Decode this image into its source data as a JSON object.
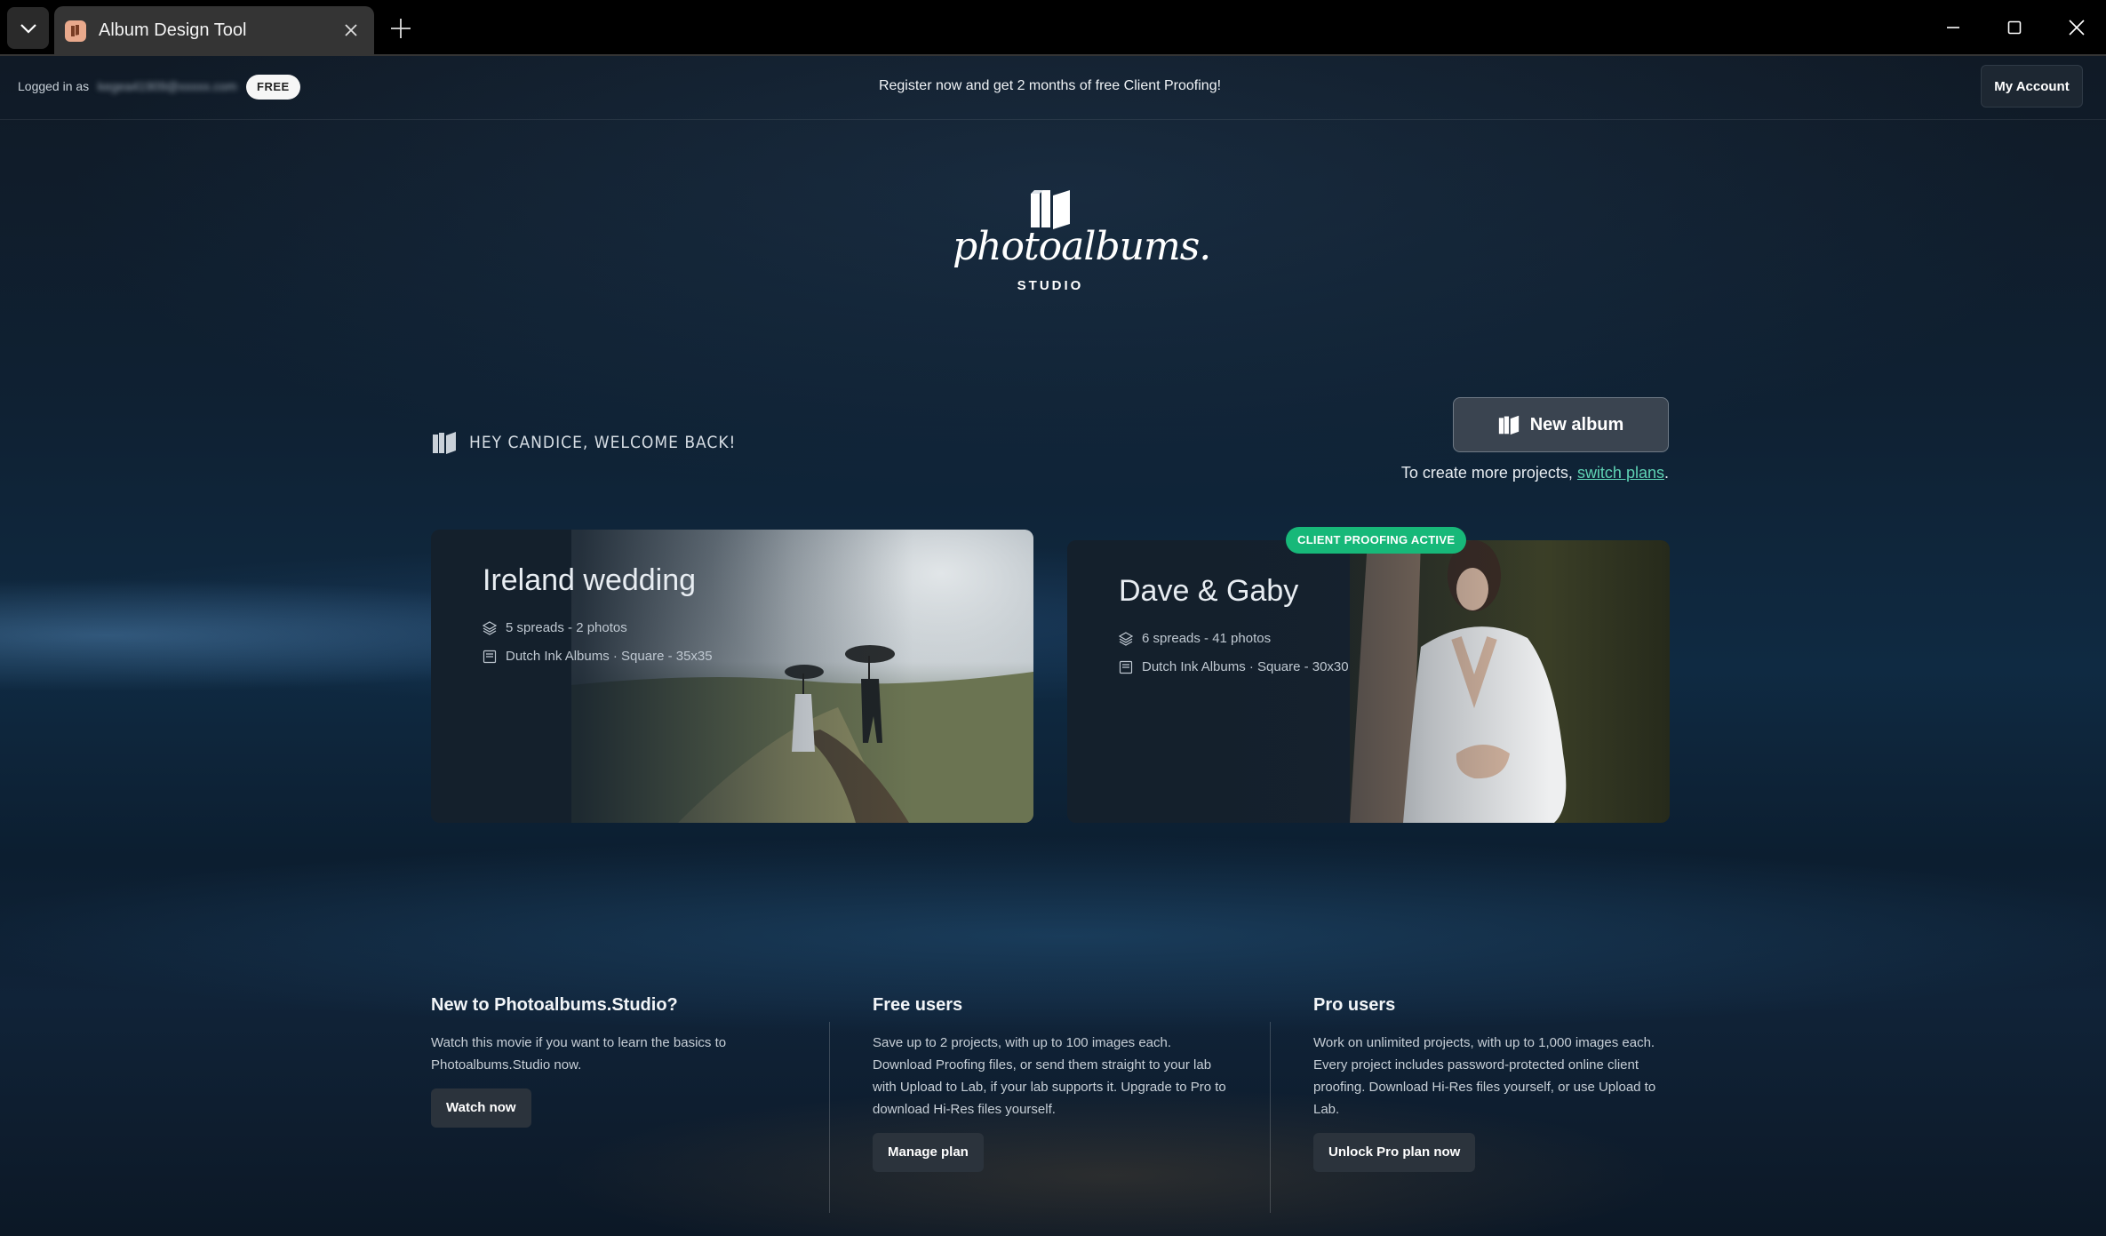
{
  "browser": {
    "tab_title": "Album Design Tool",
    "icons": [
      "chevron-down-icon",
      "close-icon",
      "plus-icon",
      "minimize-icon",
      "maximize-icon",
      "close-window-icon"
    ]
  },
  "infobar": {
    "logged_in_label": "Logged in as",
    "email": "kegea41909@xxxxx.com",
    "plan_badge": "FREE",
    "promo": "Register now and get 2 months of free Client Proofing!",
    "my_account": "My Account"
  },
  "logo": {
    "word": "photoalbums.",
    "sub": "STUDIO"
  },
  "welcome": {
    "text": "HEY CANDICE, WELCOME BACK!",
    "new_album": "New album",
    "switch_prefix": "To create more projects, ",
    "switch_link": "switch plans",
    "switch_suffix": "."
  },
  "albums": [
    {
      "title": "Ireland wedding",
      "spreads": "5 spreads - 2 photos",
      "product": "Dutch Ink Albums · Square - 35x35"
    },
    {
      "title": "Dave & Gaby",
      "spreads": "6 spreads - 41 photos",
      "product": "Dutch Ink Albums · Square - 30x30",
      "badge": "CLIENT PROOFING ACTIVE"
    }
  ],
  "info": [
    {
      "title": "New to Photoalbums.Studio?",
      "body": "Watch this movie if you want to learn the basics to Photoalbums.Studio now.",
      "button": "Watch now"
    },
    {
      "title": "Free users",
      "body": "Save up to 2 projects, with up to 100 images each. Download Proofing files, or send them straight to your lab with Upload to Lab, if your lab supports it. Upgrade to Pro to download Hi-Res files yourself.",
      "button": "Manage plan"
    },
    {
      "title": "Pro users",
      "body": "Work on unlimited projects, with up to 1,000 images each. Every project includes password-protected online client proofing. Download Hi-Res files yourself, or use Upload to Lab.",
      "button": "Unlock Pro plan now"
    }
  ],
  "colors": {
    "accent_link": "#5fd3b4",
    "proofing_badge": "#17b879"
  }
}
